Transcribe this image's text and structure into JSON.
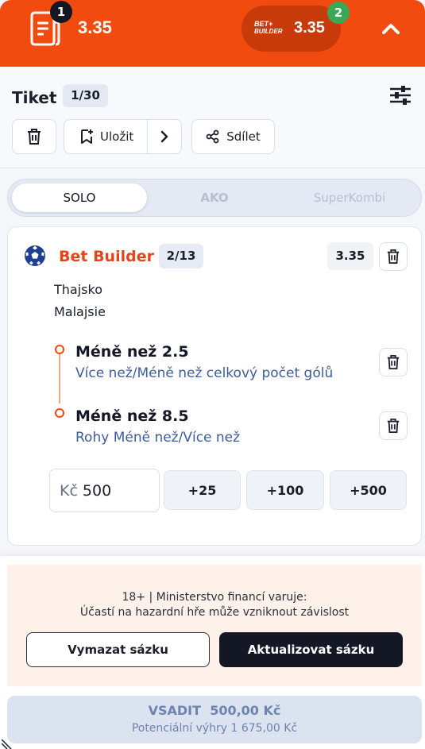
{
  "topbar": {
    "ticket_badge": "1",
    "odds": "3.35",
    "bet_builder_logo_line1": "BET+",
    "bet_builder_logo_line2": "BUILDER",
    "bet_builder_odds": "3.35",
    "bet_builder_badge": "2",
    "icons": {
      "ticket": "receipt-icon",
      "collapse": "chevron-up-icon"
    }
  },
  "ticket": {
    "title": "Tiket",
    "count": "1/30",
    "save_label": "Uložit",
    "share_label": "Sdílet",
    "icons": {
      "settings": "sliders-icon",
      "delete": "trash-icon",
      "save": "bookmark-add-icon",
      "more": "chevron-right-icon",
      "share": "share-icon"
    }
  },
  "tabs": [
    {
      "label": "SOLO",
      "active": true
    },
    {
      "label": "AKO",
      "active": false
    },
    {
      "label": "SuperKombi",
      "active": false
    }
  ],
  "bet": {
    "title": "Bet Builder",
    "count": "2/13",
    "odds": "3.35",
    "teams": [
      "Thajsko",
      "Malajsie"
    ],
    "selections": [
      {
        "title": "Méně než 2.5",
        "market": "Více než/Méně než celkový počet gólů"
      },
      {
        "title": "Méně než 8.5",
        "market": "Rohy Méně než/Více než"
      }
    ],
    "stake": {
      "currency": "Kč",
      "value": "500"
    },
    "quick_stakes": [
      "+25",
      "+100",
      "+500"
    ],
    "colors": {
      "accent": "#f24b0f",
      "title": "#e2461a",
      "market": "#3c5c9b"
    }
  },
  "footer": {
    "warning_line1": "18+ | Ministerstvo financí varuje:",
    "warning_line2": "Účastí na hazardní hře může vzniknout závislost",
    "clear_label": "Vymazat sázku",
    "update_label": "Aktualizovat sázku",
    "place_bet_label": "VSADIT  500,00 Kč",
    "potential_win": "Potenciální výhry 1 675,00 Kč"
  }
}
